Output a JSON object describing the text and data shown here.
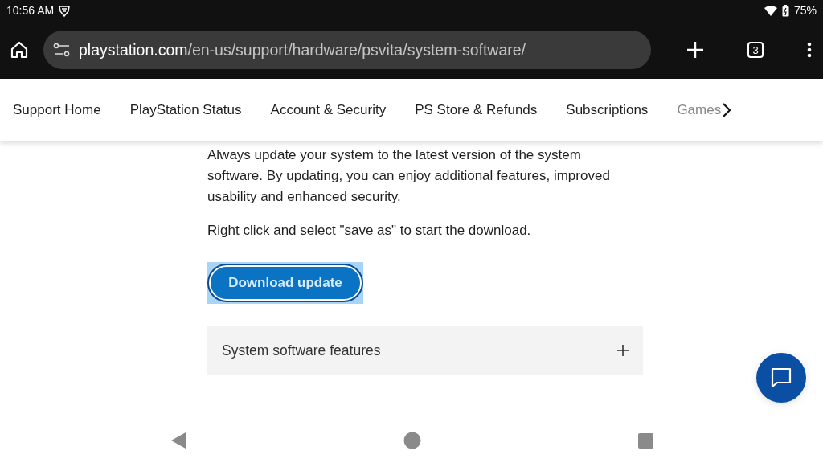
{
  "status_bar": {
    "time": "10:56 AM",
    "battery": "75%"
  },
  "browser": {
    "url_host": "playstation.com",
    "url_path": "/en-us/support/hardware/psvita/system-software/",
    "tab_count": "3"
  },
  "nav": {
    "items": [
      {
        "label": "Support Home"
      },
      {
        "label": "PlayStation Status"
      },
      {
        "label": "Account & Security"
      },
      {
        "label": "PS Store & Refunds"
      },
      {
        "label": "Subscriptions"
      },
      {
        "label": "Games"
      }
    ]
  },
  "content": {
    "paragraphs": [
      "Always update your system to the latest version of the system software. By updating, you can enjoy additional features, improved usability and enhanced security.",
      "Right click and select \"save as\" to start the download."
    ],
    "download_button": {
      "label": "Download update",
      "highlighted": true
    },
    "accordion": {
      "title": "System software features",
      "expanded": false
    }
  }
}
